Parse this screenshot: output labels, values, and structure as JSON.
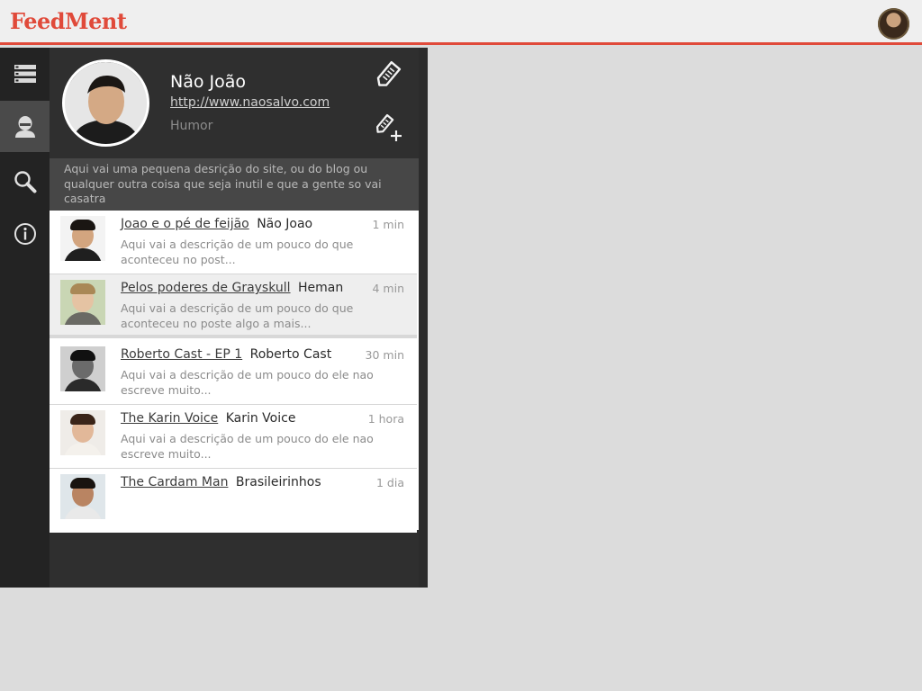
{
  "app": {
    "logo": "FeedMent",
    "colors": {
      "accent": "#e04a3a",
      "rail_bg": "#232323",
      "rail_active": "#4a4a4a",
      "panel_bg": "#2f2f2f"
    }
  },
  "rail": {
    "items": [
      {
        "icon": "feeds-list-icon",
        "active": false
      },
      {
        "icon": "profile-icon",
        "active": true
      },
      {
        "icon": "search-icon",
        "active": false
      },
      {
        "icon": "info-icon",
        "active": false
      }
    ]
  },
  "profile": {
    "name": "Não João",
    "link": "http://www.naosalvo.com",
    "category": "Humor",
    "description": "Aqui vai uma pequena desrição do site, ou do blog ou qualquer outra coisa que seja inutil e que a gente so vai casatra"
  },
  "feed": {
    "items": [
      {
        "title": "Joao e o pé de feijão",
        "author": "Não Joao",
        "time": "1 min",
        "summary": "Aqui vai a descrição de um pouco do que aconteceu no post..."
      },
      {
        "title": "Pelos poderes de Grayskull",
        "author": "Heman",
        "time": "4 min",
        "summary": "Aqui vai a descrição de um pouco do que aconteceu no poste algo a mais..."
      },
      {
        "title": "Roberto Cast - EP 1",
        "author": "Roberto Cast",
        "time": "30 min",
        "summary": "Aqui vai a descrição de um pouco do ele nao escreve muito..."
      },
      {
        "title": "The Karin Voice",
        "author": "Karin Voice",
        "time": "1 hora",
        "summary": "Aqui vai a descrição de um pouco do ele nao escreve muito..."
      },
      {
        "title": "The Cardam Man",
        "author": "Brasileirinhos",
        "time": "1 dia",
        "summary": ""
      }
    ]
  }
}
